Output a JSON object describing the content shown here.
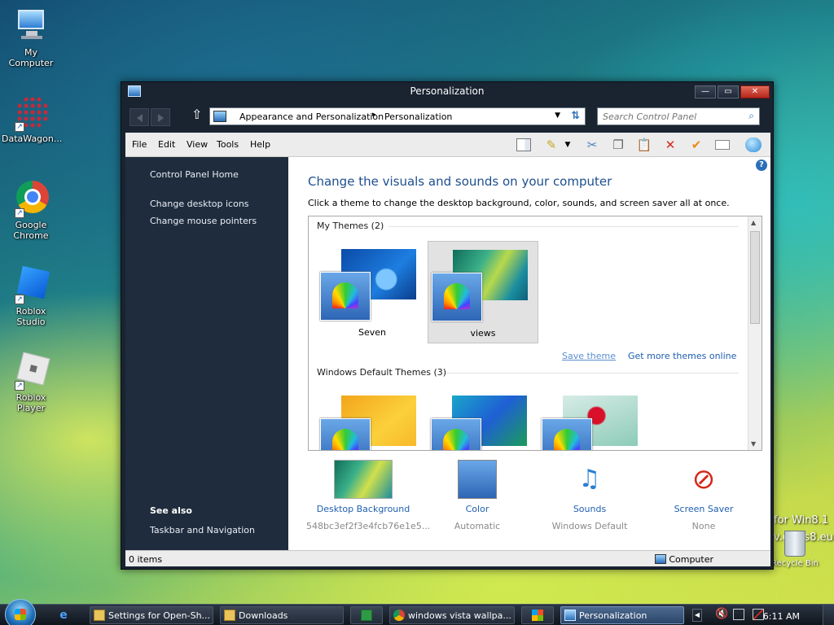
{
  "desktop": {
    "icons": [
      {
        "label": "My Computer",
        "icon": "computer-icon"
      },
      {
        "label": "DataWagon...",
        "icon": "datawagon-icon"
      },
      {
        "label": "Google Chrome",
        "icon": "chrome-icon"
      },
      {
        "label": "Roblox Studio",
        "icon": "roblox-studio-icon"
      },
      {
        "label": "Roblox Player",
        "icon": "roblox-player-icon"
      }
    ],
    "watermark_line1": "for Win8.1",
    "watermark_line2": "v.glass8.eu",
    "recycle_label": "Recycle Bin"
  },
  "window": {
    "title": "Personalization",
    "min_glyph": "—",
    "max_glyph": "▭",
    "close_glyph": "✕",
    "up_glyph": "⇧",
    "breadcrumb": [
      "Appearance and Personalization",
      "Personalization"
    ],
    "breadcrumb_sep": "▸",
    "search_placeholder": "Search Control Panel",
    "menu": [
      "File",
      "Edit",
      "View",
      "Tools",
      "Help"
    ],
    "toolbar_icons": [
      "layout-icon",
      "properties-icon",
      "cut-icon",
      "copy-icon",
      "paste-icon",
      "delete-icon",
      "check-icon",
      "rename-icon",
      "globe-icon"
    ]
  },
  "left_pane": {
    "home": "Control Panel Home",
    "links": [
      "Change desktop icons",
      "Change mouse pointers"
    ],
    "see_also_title": "See also",
    "see_also_links": [
      "Taskbar and Navigation"
    ]
  },
  "main": {
    "heading": "Change the visuals and sounds on your computer",
    "subtext": "Click a theme to change the desktop background, color, sounds, and screen saver all at once.",
    "my_themes_header": "My Themes (2)",
    "my_themes": [
      {
        "name": "Seven",
        "selected": false
      },
      {
        "name": "views",
        "selected": true
      }
    ],
    "save_theme": "Save theme",
    "get_more": "Get more themes online",
    "default_header": "Windows Default Themes (3)",
    "default_themes": [
      {
        "name": ""
      },
      {
        "name": ""
      },
      {
        "name": ""
      }
    ],
    "bottom": [
      {
        "label": "Desktop Background",
        "sub": "548bc3ef2f3e4fcb76e1e5..."
      },
      {
        "label": "Color",
        "sub": "Automatic"
      },
      {
        "label": "Sounds",
        "sub": "Windows Default"
      },
      {
        "label": "Screen Saver",
        "sub": "None"
      }
    ]
  },
  "status": {
    "items": "0 items",
    "zone": "Computer"
  },
  "taskbar": {
    "tasks": [
      {
        "label": "Settings for Open-Sh...",
        "active": false
      },
      {
        "label": "Downloads",
        "active": false
      },
      {
        "label": "",
        "active": false
      },
      {
        "label": "windows vista wallpa...",
        "active": false
      },
      {
        "label": "",
        "active": false
      },
      {
        "label": "Personalization",
        "active": true
      }
    ],
    "clock": "6:11 AM"
  },
  "colors": {
    "accent": "#1e4f8e",
    "link": "#1e5fb0",
    "pane_dark": "#1f2c3d"
  }
}
